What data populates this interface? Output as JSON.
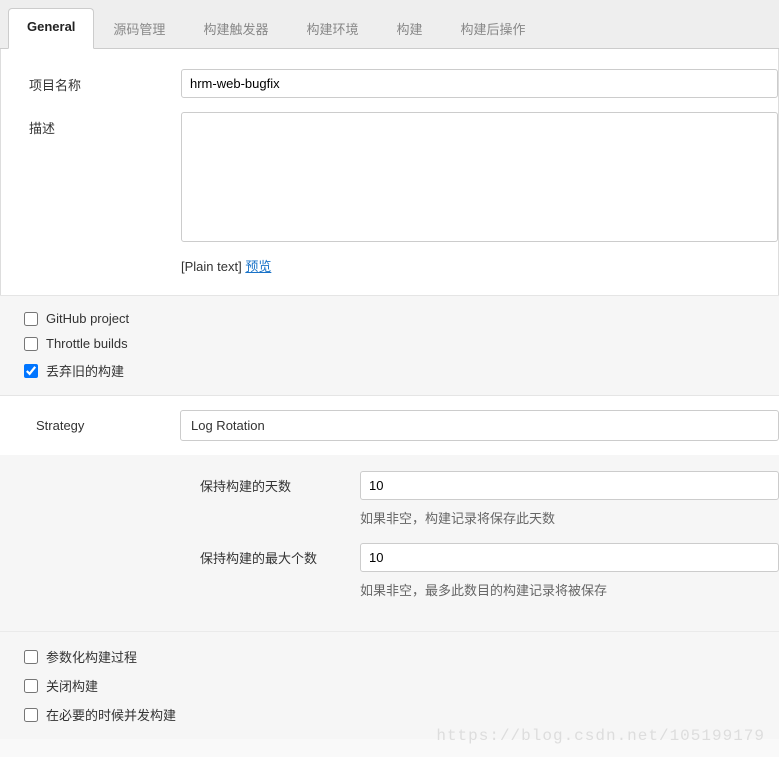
{
  "tabs": [
    {
      "label": "General",
      "active": true
    },
    {
      "label": "源码管理",
      "active": false
    },
    {
      "label": "构建触发器",
      "active": false
    },
    {
      "label": "构建环境",
      "active": false
    },
    {
      "label": "构建",
      "active": false
    },
    {
      "label": "构建后操作",
      "active": false
    }
  ],
  "form": {
    "project_name_label": "项目名称",
    "project_name_value": "hrm-web-bugfix",
    "description_label": "描述",
    "description_value": "",
    "plain_text_label": "[Plain text]",
    "preview_label": "预览"
  },
  "checkboxes1": [
    {
      "label": "GitHub project",
      "checked": false
    },
    {
      "label": "Throttle builds",
      "checked": false
    },
    {
      "label": "丢弃旧的构建",
      "checked": true
    }
  ],
  "strategy": {
    "label": "Strategy",
    "value": "Log Rotation"
  },
  "retention": {
    "days_label": "保持构建的天数",
    "days_value": "10",
    "days_help": "如果非空，构建记录将保存此天数",
    "max_label": "保持构建的最大个数",
    "max_value": "10",
    "max_help": "如果非空，最多此数目的构建记录将被保存"
  },
  "checkboxes2": [
    {
      "label": "参数化构建过程",
      "checked": false
    },
    {
      "label": "关闭构建",
      "checked": false
    },
    {
      "label": "在必要的时候并发构建",
      "checked": false
    }
  ],
  "watermark": "https://blog.csdn.net/105199179"
}
